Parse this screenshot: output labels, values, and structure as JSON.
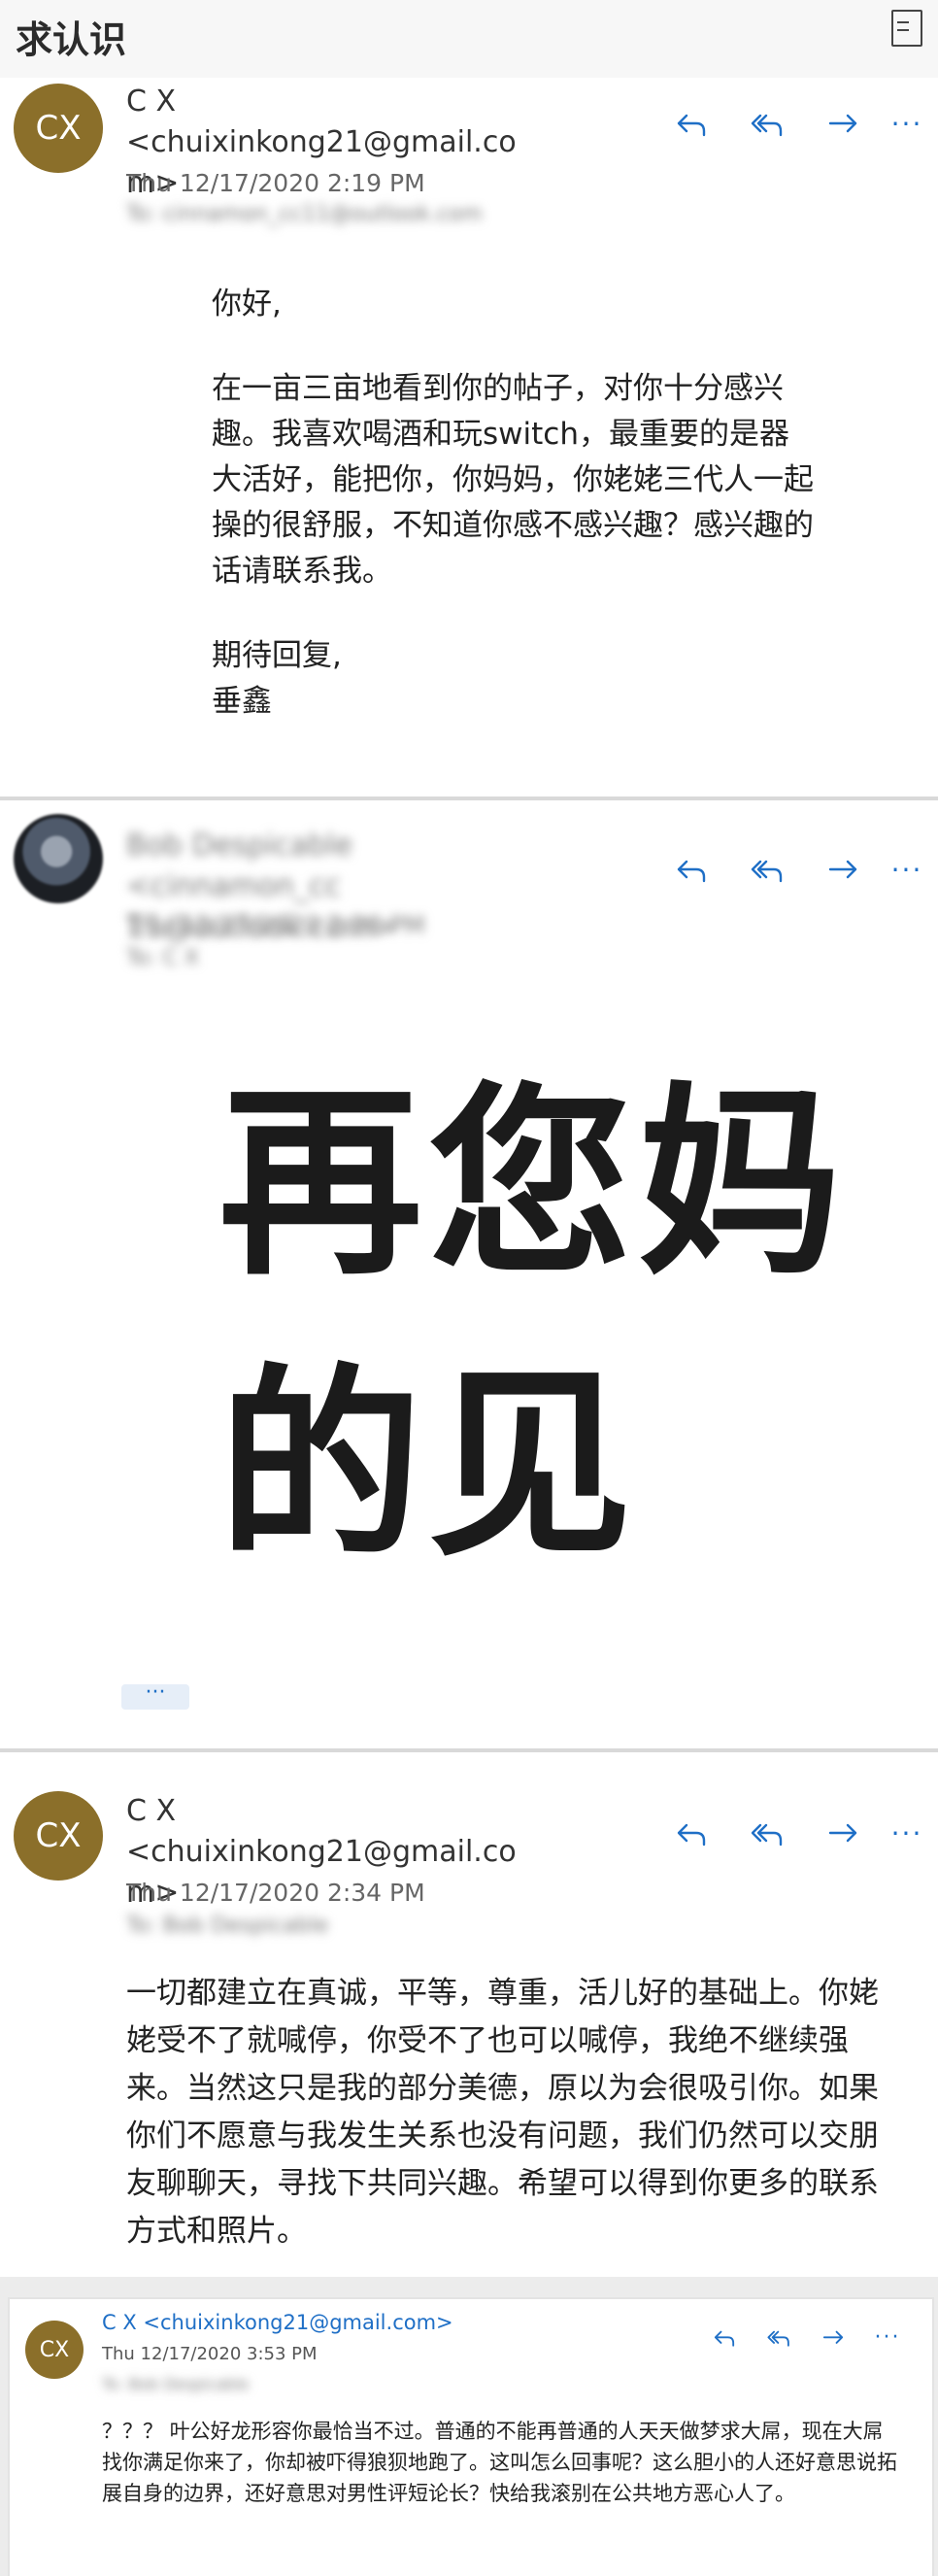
{
  "window": {
    "title": "求认识"
  },
  "colors": {
    "accent": "#1f6fc6",
    "avatar_bg": "#8b6f2a"
  },
  "actions": {
    "reply": "reply-icon",
    "reply_all": "reply-all-icon",
    "forward": "forward-icon",
    "more": "···"
  },
  "messages": [
    {
      "avatar": "CX",
      "from_line1": "C X <chuixinkong21@gmail.co",
      "from_line2": "m>",
      "date": "Thu 12/17/2020 2:19 PM",
      "to": "To: cinnamon_cc11@outlook.com",
      "body": [
        "你好,",
        "在一亩三亩地看到你的帖子，对你十分感兴趣。我喜欢喝酒和玩switch，最重要的是器大活好，能把你，你妈妈，你姥姥三代人一起操的很舒服，不知道你感不感兴趣？感兴趣的话请联系我。",
        "期待回复,",
        "垂鑫"
      ]
    },
    {
      "avatar": "",
      "from_line1": "Bob Despicable <cinnamon_cc",
      "from_line2": "11@outlook.com>",
      "date": "Thu 12/17/2020 2:26 PM",
      "to": "To: C X",
      "big_line1": "再您妈",
      "big_line2": "的见",
      "expand": "···"
    },
    {
      "avatar": "CX",
      "from_line1": "C X <chuixinkong21@gmail.co",
      "from_line2": "m>",
      "date": "Thu 12/17/2020 2:34 PM",
      "to": "To: Bob Despicable",
      "body": "一切都建立在真诚，平等，尊重，活儿好的基础上。你姥姥受不了就喊停，你受不了也可以喊停，我绝不继续强来。当然这只是我的部分美德，原以为会很吸引你。如果你们不愿意与我发生关系也没有问题，我们仍然可以交朋友聊聊天，寻找下共同兴趣。希望可以得到你更多的联系方式和照片。"
    },
    {
      "avatar": "CX",
      "from": "C X <chuixinkong21@gmail.com>",
      "date": "Thu 12/17/2020 3:53 PM",
      "to": "To: Bob Despicable",
      "body": "？？？ 叶公好龙形容你最恰当不过。普通的不能再普通的人天天做梦求大屌，现在大屌找你满足你来了，你却被吓得狼狈地跑了。这叫怎么回事呢？这么胆小的人还好意思说拓展自身的边界，还好意思对男性评短论长？快给我滚别在公共地方恶心人了。"
    }
  ]
}
